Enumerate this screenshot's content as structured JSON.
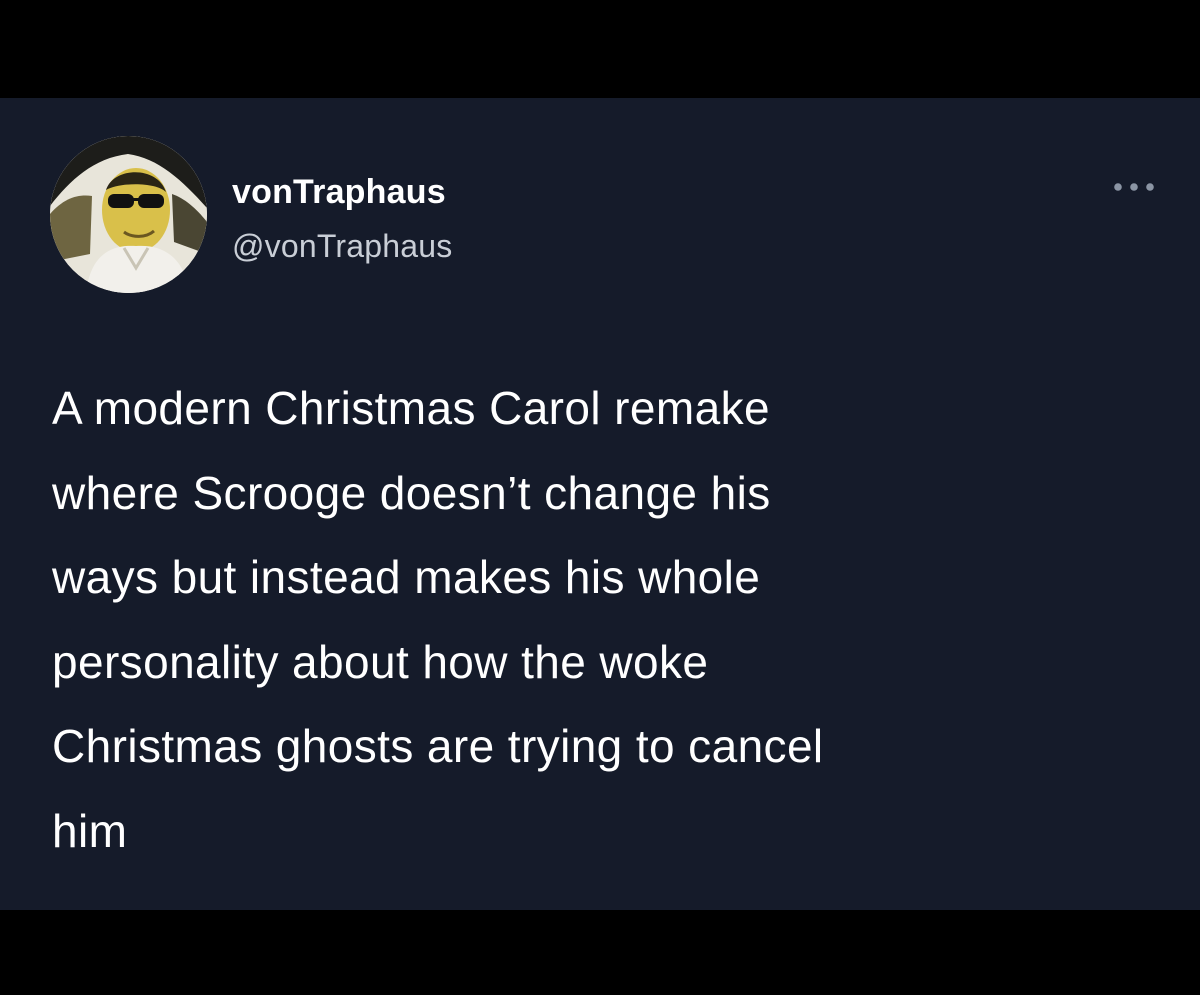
{
  "tweet": {
    "author": {
      "display_name": "vonTraphaus",
      "handle": "@vonTraphaus",
      "avatar_icon": "profile-photo"
    },
    "more_icon": "more-options-icon",
    "text": "A modern Christmas Carol remake\nwhere Scrooge doesn’t change his\nways but instead makes his whole\npersonality about how the woke\nChristmas ghosts are trying to cancel\nhim"
  },
  "colors": {
    "page_background": "#000000",
    "card_background": "#151b2a",
    "text_primary": "#ffffff",
    "text_secondary": "#c9ced6",
    "icon_muted": "#8b95a4"
  }
}
